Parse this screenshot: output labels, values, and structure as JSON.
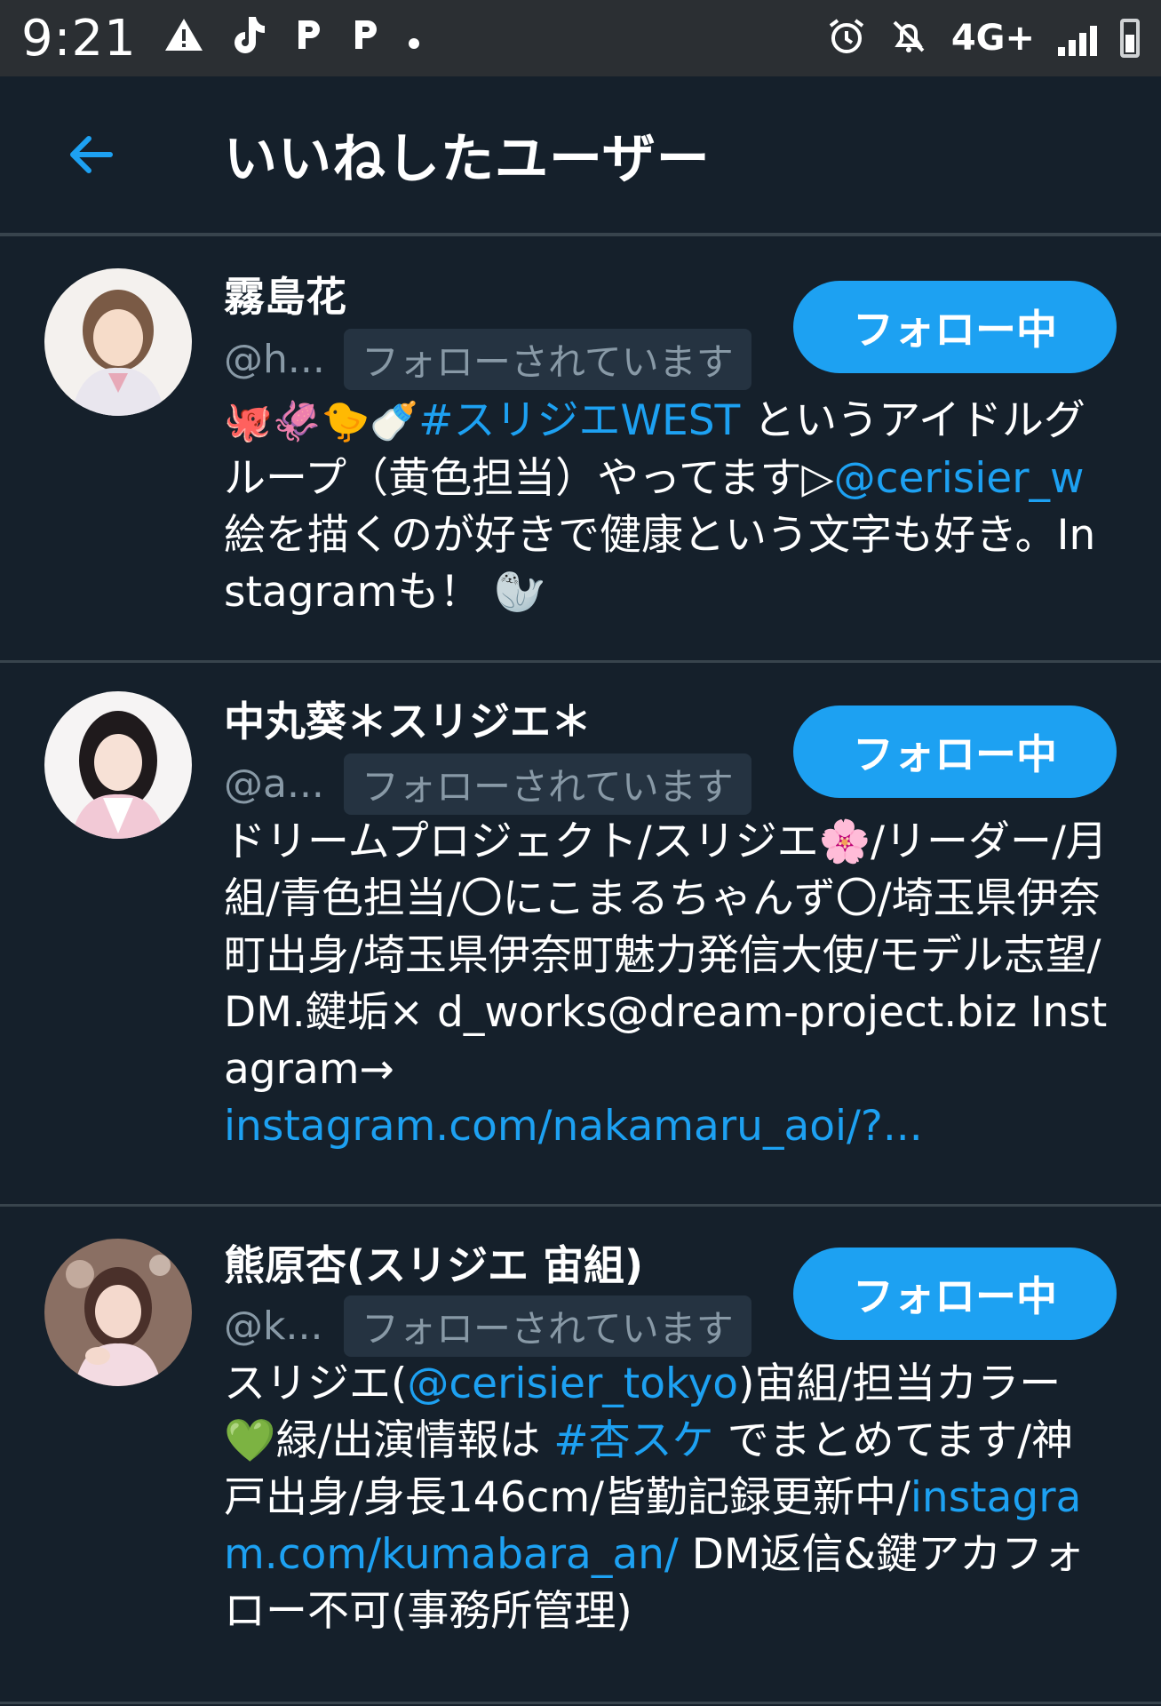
{
  "status_bar": {
    "time": "9:21",
    "left_icons": [
      "warning-icon",
      "tiktok-icon",
      "p-app-icon",
      "p-app-icon",
      "dot-icon"
    ],
    "network": "4G+",
    "right_icons": [
      "alarm-icon",
      "bell-off-icon",
      "signal-icon",
      "battery-icon"
    ]
  },
  "header": {
    "back_icon": "arrow-left-icon",
    "title": "いいねしたユーザー"
  },
  "colors": {
    "background": "#15202b",
    "accent": "#1da1f2",
    "secondary_text": "#8899a6",
    "divider": "#38444d"
  },
  "users": [
    {
      "name": "霧島花",
      "handle": "@h...",
      "follows_you": "フォローされています",
      "follow_button": "フォロー中",
      "bio_emoji": "🐙🦑🐤🍼",
      "bio_hashtag": "#スリジエWEST",
      "bio_text1": " というアイドルグループ（黄色担当）やってます▷",
      "bio_mention": "@cerisier_w",
      "bio_text2": " 絵を描くのが好きで健康という文字も好き。Instagramも！ 🦭"
    },
    {
      "name": "中丸葵＊スリジエ＊",
      "handle": "@a...",
      "follows_you": "フォローされています",
      "follow_button": "フォロー中",
      "bio_text1": "ドリームプロジェクト/スリジエ🌸/リーダー/月組/青色担当/〇にこまるちゃんず〇/埼玉県伊奈町出身/埼玉県伊奈町魅力発信大使/モデル志望/ DM.鍵垢× d_works@dream-project.biz Instagram→",
      "bio_link": "instagram.com/nakamaru_aoi/?..."
    },
    {
      "name": "熊原杏(スリジエ 宙組)",
      "handle": "@k...",
      "follows_you": "フォローされています",
      "follow_button": "フォロー中",
      "bio_text1": "スリジエ(",
      "bio_mention": "@cerisier_tokyo",
      "bio_text2": ")宙組/担当カラー💚緑/出演情報は ",
      "bio_hashtag": "#杏スケ",
      "bio_text3": " でまとめてます/神戸出身/身長146cm/皆勤記録更新中/",
      "bio_link": "instagram.com/kumabara_an/",
      "bio_text4": " DM返信&鍵アカフォロー不可(事務所管理)"
    }
  ]
}
